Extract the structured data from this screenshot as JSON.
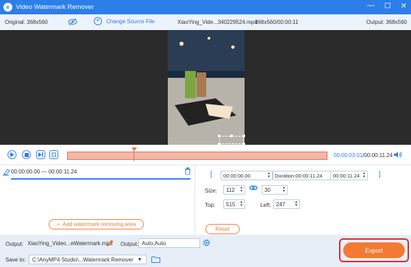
{
  "titlebar": {
    "title": "Video Watermark Remover",
    "logo_letter": "e"
  },
  "infobar": {
    "original": "Original: 368x560",
    "change_source": "Change Source File",
    "file_name": "XiaoYing_Vide...340229524.mp4",
    "file_dims": "368x560/00:00:11",
    "output": "Output: 368x560"
  },
  "player": {
    "time_current": "00:00:03.01",
    "time_total": "/00:00:11.24",
    "progress": 0.26
  },
  "left_panel": {
    "range_time": "00:00:00.00 — 00:00:11.24",
    "add_area_label": "Add watermark removing area"
  },
  "right_panel": {
    "start_time": "00:00:00.00",
    "duration": "Duration:00:00:11.24",
    "end_time": "00:00:11.24",
    "size_label": "Size:",
    "width": "112",
    "height": "30",
    "top_label": "Top:",
    "top_value": "515",
    "left_label": "Left:",
    "left_value": "247",
    "reset_label": "Reset"
  },
  "bottombar": {
    "output_label": "Output:",
    "output_name": "XiaoYing_Video...eWatermark.mp4",
    "output_fmt_label": "Output:",
    "output_fmt": "Auto;Auto",
    "save_label": "Save to:",
    "save_path": "C:\\AnyMP4 Studio\\...Watermark Remover",
    "export_label": "Export"
  },
  "colors": {
    "accent": "#2c7ee8",
    "orange": "#f47a33",
    "highlight": "#e02424"
  }
}
